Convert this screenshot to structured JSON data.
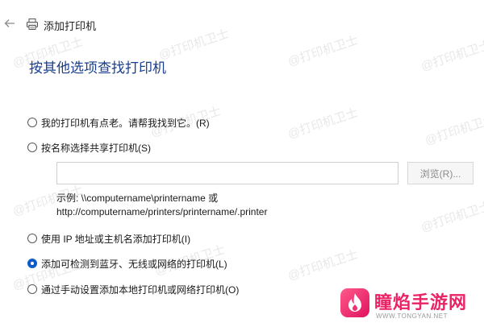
{
  "window": {
    "title": "添加打印机"
  },
  "heading": "按其他选项查找打印机",
  "options": [
    {
      "label": "我的打印机有点老。请帮我找到它。(R)",
      "selected": false
    },
    {
      "label": "按名称选择共享打印机(S)",
      "selected": false
    },
    {
      "label": "使用 IP 地址或主机名添加打印机(I)",
      "selected": false
    },
    {
      "label": "添加可检测到蓝牙、无线或网络的打印机(L)",
      "selected": true
    },
    {
      "label": "通过手动设置添加本地打印机或网络打印机(O)",
      "selected": false
    }
  ],
  "share_printer": {
    "input_value": "",
    "browse_label": "浏览(R)...",
    "example_line1": "示例: \\\\computername\\printername 或",
    "example_line2": "http://computername/printers/printername/.printer"
  },
  "watermark": "@打印机卫士",
  "brand": {
    "name": "瞳焰手游网",
    "url": "WWW.TONGYAN.NET"
  },
  "colors": {
    "heading": "#1a3f8f",
    "radio_selected": "#0f5cc8",
    "brand": "#ea2266"
  }
}
